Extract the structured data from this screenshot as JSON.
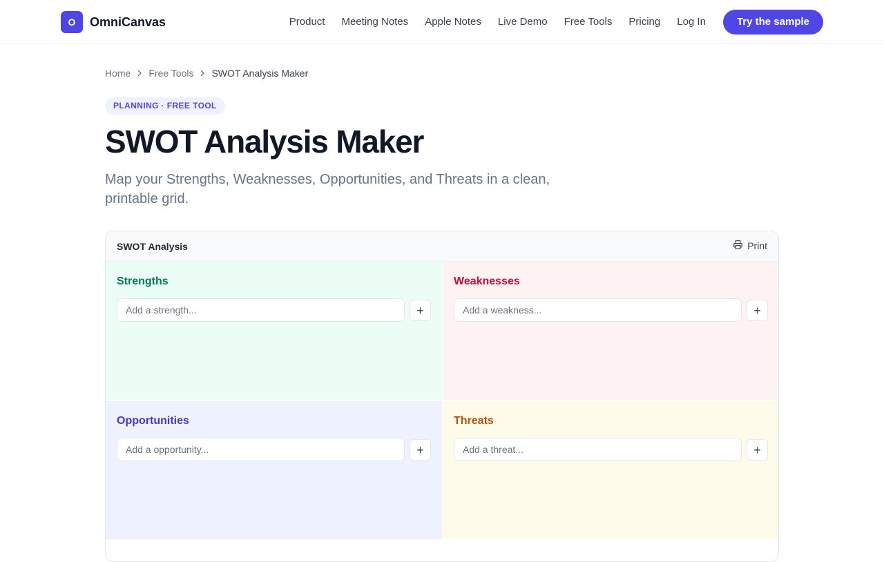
{
  "brand": {
    "mark": "O",
    "name": "OmniCanvas",
    "accent": "#4f46e5"
  },
  "nav": {
    "links": [
      "Product",
      "Meeting Notes",
      "Apple Notes",
      "Live Demo",
      "Free Tools",
      "Pricing",
      "Log In"
    ],
    "cta": "Try the sample"
  },
  "breadcrumb": {
    "home": "Home",
    "section": "Free Tools",
    "current": "SWOT Analysis Maker"
  },
  "tag": "PLANNING · FREE TOOL",
  "title": "SWOT Analysis Maker",
  "subtitle": "Map your Strengths, Weaknesses, Opportunities, and Threats in a clean, printable grid.",
  "card": {
    "title": "SWOT Analysis",
    "print_label": "Print",
    "quadrants": [
      {
        "title": "Strengths",
        "placeholder": "Add a strength...",
        "value": "",
        "color": "#047857",
        "bg": "#ecfdf5"
      },
      {
        "title": "Weaknesses",
        "placeholder": "Add a weakness...",
        "value": "",
        "color": "#be123c",
        "bg": "#fef2f2"
      },
      {
        "title": "Opportunities",
        "placeholder": "Add a opportunity...",
        "value": "",
        "color": "#4338ca",
        "bg": "#eef2ff"
      },
      {
        "title": "Threats",
        "placeholder": "Add a threat...",
        "value": "",
        "color": "#b45309",
        "bg": "#fffbeb"
      }
    ],
    "add_label": "+"
  },
  "icons": {
    "breadcrumb_separator": "chevron-right-icon",
    "print": "printer-icon",
    "add": "plus-icon"
  }
}
